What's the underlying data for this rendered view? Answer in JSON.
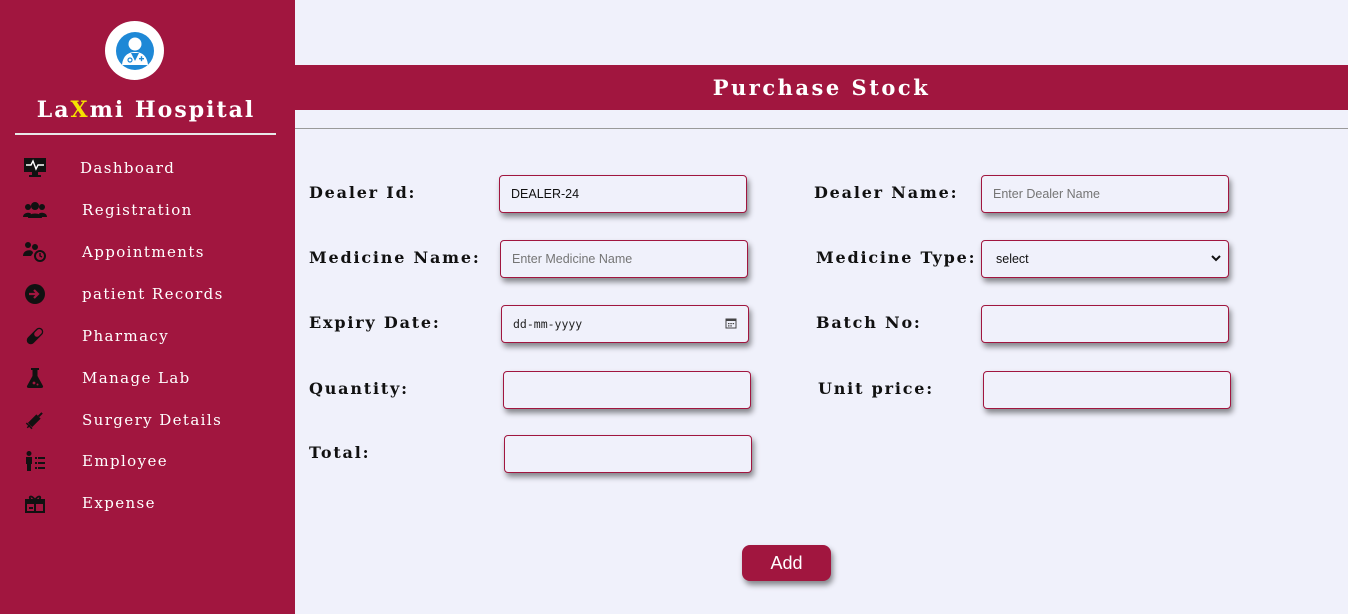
{
  "sidebar": {
    "brand": {
      "part1": "La",
      "highlight": "X",
      "part2": "mi Hospital"
    },
    "brand_highlight_color": "#f5e400",
    "accent_color": "#a1163f",
    "items": [
      {
        "label": "Dashboard",
        "icon": "monitor-heartbeat-icon"
      },
      {
        "label": "Registration",
        "icon": "users-group-icon"
      },
      {
        "label": "Appointments",
        "icon": "people-clock-icon"
      },
      {
        "label": "patient Records",
        "icon": "sign-in-circle-icon"
      },
      {
        "label": "Pharmacy",
        "icon": "capsule-icon"
      },
      {
        "label": "Manage Lab",
        "icon": "flask-icon"
      },
      {
        "label": "Surgery Details",
        "icon": "syringe-icon"
      },
      {
        "label": "Employee",
        "icon": "person-list-icon"
      },
      {
        "label": "Expense",
        "icon": "gift-card-icon"
      }
    ]
  },
  "page": {
    "title": "Purchase Stock"
  },
  "form": {
    "dealer_id": {
      "label": "Dealer Id:",
      "value": "DEALER-24"
    },
    "dealer_name": {
      "label": "Dealer Name:",
      "placeholder": "Enter Dealer Name"
    },
    "medicine_name": {
      "label": "Medicine Name:",
      "placeholder": "Enter Medicine Name"
    },
    "medicine_type": {
      "label": "Medicine Type:",
      "value": "select"
    },
    "expiry_date": {
      "label": "Expiry Date:",
      "placeholder": "dd-mm-yyyy"
    },
    "batch_no": {
      "label": "Batch No:",
      "value": ""
    },
    "quantity": {
      "label": "Quantity:",
      "value": ""
    },
    "unit_price": {
      "label": "Unit price:",
      "value": ""
    },
    "total": {
      "label": "Total:",
      "value": ""
    },
    "add_label": "Add"
  }
}
